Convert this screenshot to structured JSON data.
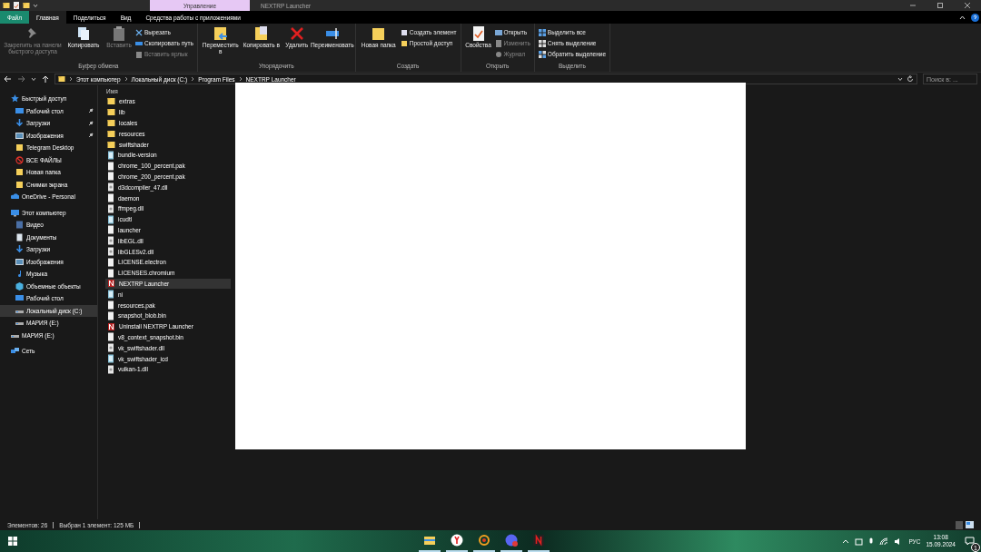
{
  "window": {
    "context_tab": "Управление",
    "title": "NEXTRP Launcher"
  },
  "ribbon_tabs": [
    {
      "label": "Файл",
      "kind": "file",
      "selected": false
    },
    {
      "label": "Главная",
      "kind": "tab",
      "selected": true
    },
    {
      "label": "Поделиться",
      "kind": "tab",
      "selected": false
    },
    {
      "label": "Вид",
      "kind": "tab",
      "selected": false
    },
    {
      "label": "Средства работы с приложениями",
      "kind": "tab",
      "selected": false
    }
  ],
  "ribbon_groups": [
    {
      "label": "Буфер обмена",
      "items": [
        {
          "kind": "large",
          "label": "Закрепить на панели быстрого доступа",
          "disabled": true
        },
        {
          "kind": "large",
          "label": "Копировать",
          "disabled": false
        },
        {
          "kind": "large",
          "label": "Вставить",
          "disabled": true
        },
        {
          "kind": "stack",
          "items": [
            {
              "label": "Вырезать",
              "disabled": false
            },
            {
              "label": "Скопировать путь",
              "disabled": false
            },
            {
              "label": "Вставить ярлык",
              "disabled": true
            }
          ]
        }
      ]
    },
    {
      "label": "Упорядочить",
      "items": [
        {
          "kind": "large",
          "label": "Переместить в",
          "disabled": false
        },
        {
          "kind": "large",
          "label": "Копировать в",
          "disabled": false
        },
        {
          "kind": "large",
          "label": "Удалить",
          "disabled": false
        },
        {
          "kind": "large",
          "label": "Переименовать",
          "disabled": false
        }
      ]
    },
    {
      "label": "Создать",
      "items": [
        {
          "kind": "large",
          "label": "Новая папка",
          "disabled": false
        },
        {
          "kind": "stack",
          "items": [
            {
              "label": "Создать элемент",
              "disabled": false
            },
            {
              "label": "Простой доступ",
              "disabled": false
            }
          ]
        }
      ]
    },
    {
      "label": "Открыть",
      "items": [
        {
          "kind": "large",
          "label": "Свойства",
          "disabled": false
        },
        {
          "kind": "stack",
          "items": [
            {
              "label": "Открыть",
              "disabled": false
            },
            {
              "label": "Изменить",
              "disabled": true
            },
            {
              "label": "Журнал",
              "disabled": true
            }
          ]
        }
      ]
    },
    {
      "label": "Выделить",
      "items": [
        {
          "kind": "stack",
          "items": [
            {
              "label": "Выделить все",
              "disabled": false
            },
            {
              "label": "Снять выделение",
              "disabled": false
            },
            {
              "label": "Обратить выделение",
              "disabled": false
            }
          ]
        }
      ]
    }
  ],
  "breadcrumb": [
    "Этот компьютер",
    "Локальный диск (C:)",
    "Program Files",
    "NEXTRP Launcher"
  ],
  "search": {
    "placeholder": "Поиск в: ..."
  },
  "sidebar": [
    {
      "label": "Быстрый доступ",
      "kind": "star",
      "selected": false,
      "children": [
        {
          "label": "Рабочий стол",
          "kind": "desktop",
          "pinned": true,
          "selected": false
        },
        {
          "label": "Загрузки",
          "kind": "download",
          "pinned": true,
          "selected": false
        },
        {
          "label": "Изображения",
          "kind": "pictures",
          "pinned": true,
          "selected": false
        },
        {
          "label": "Telegram Desktop",
          "kind": "folder",
          "pinned": false,
          "selected": false
        },
        {
          "label": "ВСЕ ФАЙЛЫ",
          "kind": "blocked",
          "pinned": false,
          "selected": false
        },
        {
          "label": "Новая папка",
          "kind": "folder",
          "pinned": false,
          "selected": false
        },
        {
          "label": "Снимки экрана",
          "kind": "folder",
          "pinned": false,
          "selected": false
        }
      ]
    },
    {
      "label": "OneDrive - Personal",
      "kind": "cloud",
      "selected": false
    },
    {
      "label": "Этот компьютер",
      "kind": "pc",
      "selected": false,
      "children": [
        {
          "label": "Видео",
          "kind": "video",
          "selected": false
        },
        {
          "label": "Документы",
          "kind": "docs",
          "selected": false
        },
        {
          "label": "Загрузки",
          "kind": "download",
          "selected": false
        },
        {
          "label": "Изображения",
          "kind": "pictures",
          "selected": false
        },
        {
          "label": "Музыка",
          "kind": "music",
          "selected": false
        },
        {
          "label": "Объемные объекты",
          "kind": "cube",
          "selected": false
        },
        {
          "label": "Рабочий стол",
          "kind": "desktop",
          "selected": false
        },
        {
          "label": "Локальный диск (C:)",
          "kind": "drive",
          "selected": true
        },
        {
          "label": "МАРИЯ (E:)",
          "kind": "drive",
          "selected": false
        }
      ]
    },
    {
      "label": "МАРИЯ (E:)",
      "kind": "drive",
      "selected": false
    },
    {
      "label": "Сеть",
      "kind": "network",
      "selected": false
    }
  ],
  "columns": [
    "Имя"
  ],
  "files": [
    {
      "name": "extras",
      "kind": "folder",
      "selected": false
    },
    {
      "name": "lib",
      "kind": "folder",
      "selected": false
    },
    {
      "name": "locales",
      "kind": "folder",
      "selected": false
    },
    {
      "name": "resources",
      "kind": "folder",
      "selected": false
    },
    {
      "name": "swiftshader",
      "kind": "folder",
      "selected": false
    },
    {
      "name": "bundle-version",
      "kind": "config",
      "selected": false
    },
    {
      "name": "chrome_100_percent.pak",
      "kind": "file",
      "selected": false
    },
    {
      "name": "chrome_200_percent.pak",
      "kind": "file",
      "selected": false
    },
    {
      "name": "d3dcompiler_47.dll",
      "kind": "dll",
      "selected": false
    },
    {
      "name": "daemon",
      "kind": "file",
      "selected": false
    },
    {
      "name": "ffmpeg.dll",
      "kind": "dll",
      "selected": false
    },
    {
      "name": "icudtl",
      "kind": "config",
      "selected": false
    },
    {
      "name": "launcher",
      "kind": "file",
      "selected": false
    },
    {
      "name": "libEGL.dll",
      "kind": "dll",
      "selected": false
    },
    {
      "name": "libGLESv2.dll",
      "kind": "dll",
      "selected": false
    },
    {
      "name": "LICENSE.electron",
      "kind": "file",
      "selected": false
    },
    {
      "name": "LICENSES.chromium",
      "kind": "file",
      "selected": false
    },
    {
      "name": "NEXTRP Launcher",
      "kind": "app",
      "selected": true
    },
    {
      "name": "ni",
      "kind": "config",
      "selected": false
    },
    {
      "name": "resources.pak",
      "kind": "file",
      "selected": false
    },
    {
      "name": "snapshot_blob.bin",
      "kind": "file",
      "selected": false
    },
    {
      "name": "Uninstall NEXTRP Launcher",
      "kind": "app",
      "selected": false
    },
    {
      "name": "v8_context_snapshot.bin",
      "kind": "file",
      "selected": false
    },
    {
      "name": "vk_swiftshader.dll",
      "kind": "dll",
      "selected": false
    },
    {
      "name": "vk_swiftshader_icd",
      "kind": "config",
      "selected": false
    },
    {
      "name": "vulkan-1.dll",
      "kind": "dll",
      "selected": false
    }
  ],
  "status_bar": [
    "Элементов: 26",
    "Выбран 1 элемент: 125 МБ"
  ],
  "taskbar": {
    "apps": [
      {
        "running": true
      },
      {
        "running": true
      },
      {
        "running": true
      },
      {
        "running": true
      },
      {
        "running": true
      }
    ],
    "language": "РУС",
    "time": "13:08",
    "date": "15.09.2024",
    "notifications": "1"
  }
}
